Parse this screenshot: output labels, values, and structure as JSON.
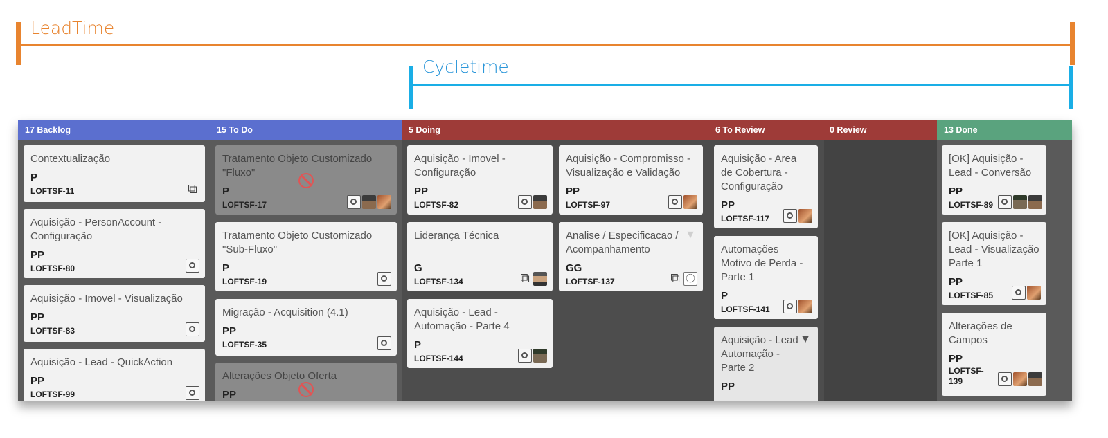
{
  "annotations": {
    "leadtime": "LeadTime",
    "cycletime": "Cycletime"
  },
  "colors": {
    "leadtime": "#e8842f",
    "cycletime": "#1aaee6",
    "header_blue": "#5b6fcf",
    "header_red": "#9e3b38",
    "header_green": "#5aa37e"
  },
  "board": {
    "columns": [
      {
        "count": "17",
        "name": "Backlog",
        "label": "17 Backlog"
      },
      {
        "count": "15",
        "name": "To Do",
        "label": "15 To Do"
      },
      {
        "count": "5",
        "name": "Doing",
        "label": "5 Doing"
      },
      {
        "count": "6",
        "name": "To Review",
        "label": "6 To Review"
      },
      {
        "count": "0",
        "name": "Review",
        "label": "0 Review"
      },
      {
        "count": "13",
        "name": "Done",
        "label": "13 Done"
      }
    ],
    "cards": {
      "backlog": [
        {
          "title": "Contextualização",
          "size": "P",
          "id": "LOFTSF-11",
          "icons": [
            "sync-icon"
          ]
        },
        {
          "title": "Aquisição - PersonAccount - Configuração",
          "size": "PP",
          "id": "LOFTSF-80",
          "icons": [
            "gear-icon"
          ]
        },
        {
          "title": "Aquisição - Imovel - Visualização",
          "size": "PP",
          "id": "LOFTSF-83",
          "icons": [
            "gear-icon"
          ]
        },
        {
          "title": "Aquisição - Lead - QuickAction",
          "size": "PP",
          "id": "LOFTSF-99",
          "icons": [
            "gear-icon"
          ]
        }
      ],
      "todo": [
        {
          "title": "Tratamento Objeto Customizado \"Fluxo\"",
          "size": "P",
          "id": "LOFTSF-17",
          "blocked": true
        },
        {
          "title": "Tratamento Objeto Customizado \"Sub-Fluxo\"",
          "size": "P",
          "id": "LOFTSF-19"
        },
        {
          "title": "Migração - Acquisition (4.1)",
          "size": "PP",
          "id": "LOFTSF-35"
        },
        {
          "title": "Alterações Objeto Oferta",
          "size": "PP",
          "id": "",
          "blocked": true
        }
      ],
      "doing": [
        {
          "title": "Aquisição - Imovel - Configuração",
          "size": "PP",
          "id": "LOFTSF-82"
        },
        {
          "title": "Aquisição - Compromisso - Visualização e Validação",
          "size": "PP",
          "id": "LOFTSF-97"
        },
        {
          "title": "Liderança Técnica",
          "size": "G",
          "id": "LOFTSF-134"
        },
        {
          "title": "Analise / Especificacao / Acompanhamento",
          "size": "GG",
          "id": "LOFTSF-137"
        },
        {
          "title": "Aquisição - Lead - Automação - Parte 4",
          "size": "P",
          "id": "LOFTSF-144"
        }
      ],
      "to_review": [
        {
          "title": "Aquisição - Area de Cobertura - Configuração",
          "size": "PP",
          "id": "LOFTSF-117"
        },
        {
          "title": "Automações Motivo de Perda - Parte 1",
          "size": "P",
          "id": "LOFTSF-141"
        },
        {
          "title": "Aquisição - Lead Automação - Parte 2",
          "size": "PP",
          "id": ""
        }
      ],
      "done": [
        {
          "title": "[OK] Aquisição - Lead - Conversão",
          "size": "PP",
          "id": "LOFTSF-89"
        },
        {
          "title": "[OK] Aquisição - Lead - Visualização Parte 1",
          "size": "PP",
          "id": "LOFTSF-85"
        },
        {
          "title": "Alterações de Campos",
          "size": "PP",
          "id": "LOFTSF-139",
          "id_display": "LOFTSF-\n139"
        }
      ]
    }
  }
}
